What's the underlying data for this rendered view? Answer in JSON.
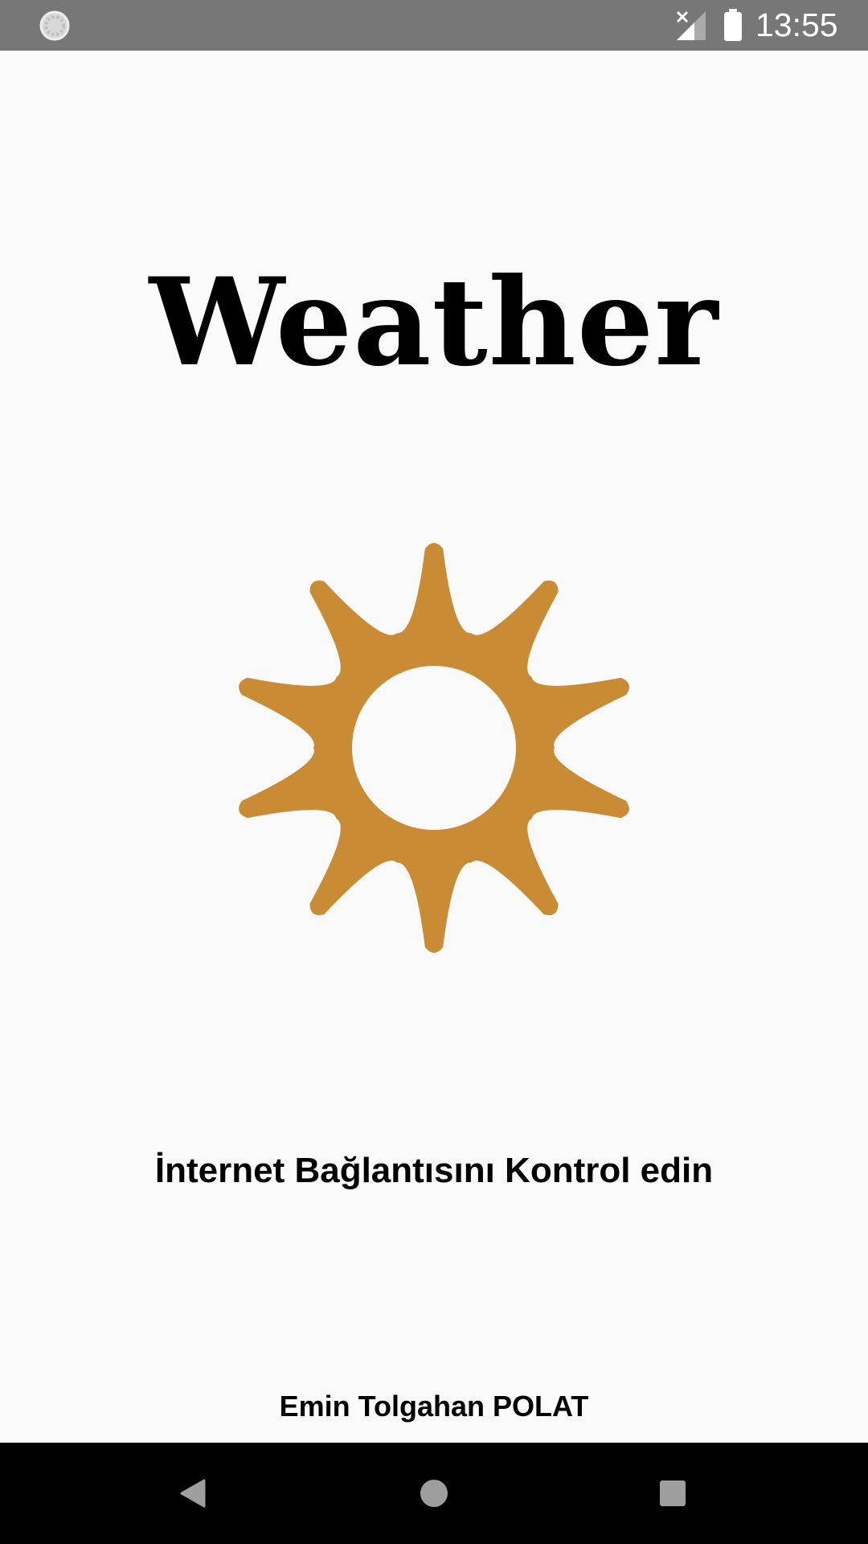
{
  "status_bar": {
    "time": "13:55",
    "icons": [
      "loading-icon",
      "signal-off-icon",
      "battery-icon"
    ],
    "background": "#777777"
  },
  "app": {
    "title": "Weather",
    "message": "İnternet Bağlantısını Kontrol edin",
    "author": "Emin Tolgahan POLAT",
    "sun_color": "#c98b33",
    "icon": "sun-icon"
  },
  "nav_bar": {
    "buttons": [
      "back-icon",
      "home-icon",
      "recents-icon"
    ]
  }
}
